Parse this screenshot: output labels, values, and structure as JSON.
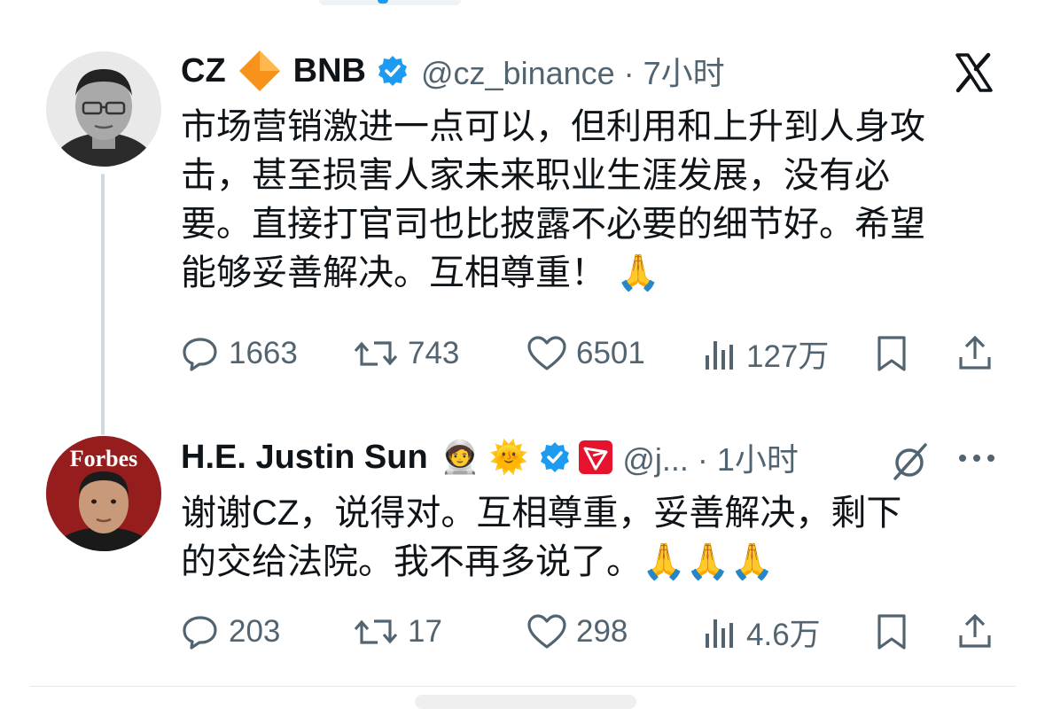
{
  "tweet1": {
    "name": "CZ",
    "name_suffix": "BNB",
    "handle_time": "@cz_binance · 7小时",
    "text_lines": [
      "市场营销激进一点可以，但利用和上升到人身攻",
      "击，甚至损害人家未来职业生涯发展，没有必",
      "要。直接打官司也比披露不必要的细节好。希望",
      "能够妥善解决。互相尊重！ 🙏"
    ],
    "replies": "1663",
    "reposts": "743",
    "likes": "6501",
    "views": "127万"
  },
  "tweet2": {
    "name": "H.E. Justin Sun",
    "emojis": "🧑‍🚀 🌞",
    "handle_time": "@j... · 1小时",
    "avatar_text": "Forbes",
    "text_lines": [
      "谢谢CZ，说得对。互相尊重，妥善解决，剩下",
      "的交给法院。我不再多说了。🙏🙏🙏"
    ],
    "replies": "203",
    "reposts": "17",
    "likes": "298",
    "views": "4.6万"
  },
  "icons": {
    "logo": "x-logo-icon",
    "verified": "verified-badge-icon",
    "diamond": "bnb-diamond-icon",
    "tron": "tron-logo-icon",
    "reply": "reply-icon",
    "repost": "repost-icon",
    "like": "heart-icon",
    "views": "views-icon",
    "bookmark": "bookmark-icon",
    "share": "share-icon",
    "grok": "grok-icon",
    "more": "more-icon"
  },
  "colors": {
    "verified_blue": "#1d9bf0",
    "bnb_orange": "#f7931a",
    "tron_red": "#e5132d",
    "muted_text": "#536471"
  }
}
